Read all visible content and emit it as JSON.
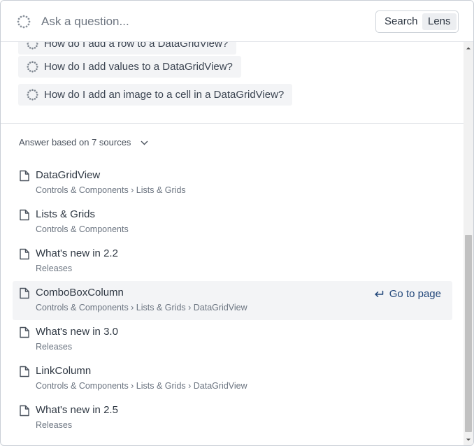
{
  "search": {
    "placeholder": "Ask a question...",
    "modes": [
      "Search",
      "Lens"
    ],
    "active_mode": "Lens"
  },
  "suggestions": [
    "How do I add a row to a DataGridView?",
    "How do I add values to a DataGridView?",
    "How do I add an image to a cell in a DataGridView?"
  ],
  "answer_sources_label": "Answer based on 7 sources",
  "sources": [
    {
      "title": "DataGridView",
      "path": "Controls & Components › Lists & Grids"
    },
    {
      "title": "Lists & Grids",
      "path": "Controls & Components"
    },
    {
      "title": "What's new in 2.2",
      "path": "Releases"
    },
    {
      "title": "ComboBoxColumn",
      "path": "Controls & Components › Lists & Grids › DataGridView"
    },
    {
      "title": "What's new in 3.0",
      "path": "Releases"
    },
    {
      "title": "LinkColumn",
      "path": "Controls & Components › Lists & Grids › DataGridView"
    },
    {
      "title": "What's new in 2.5",
      "path": "Releases"
    }
  ],
  "goto_label": "Go to page",
  "colors": {
    "link": "#22477a",
    "highlight_bg": "#f3f4f6",
    "chip_bg": "#f3f4f6"
  },
  "icons": {
    "header": "spinner-icon",
    "suggestion": "spinner-icon",
    "source": "document-icon",
    "goto": "return-arrow-icon",
    "sources_toggle": "chevron-down-icon"
  }
}
